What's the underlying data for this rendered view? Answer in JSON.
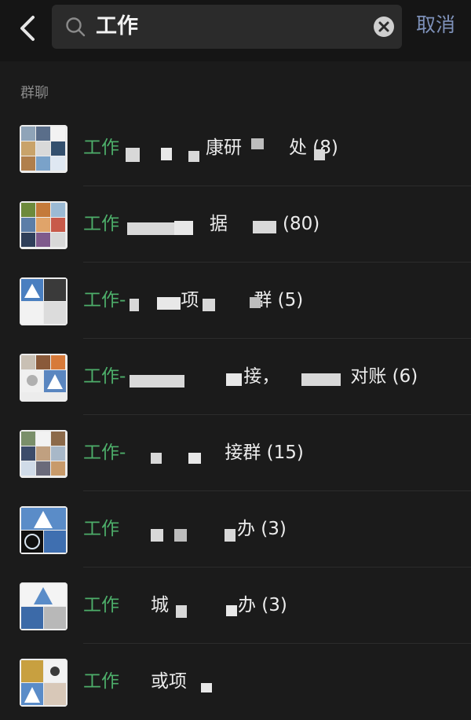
{
  "header": {
    "query": "工作",
    "cancel_label": "取消"
  },
  "section_label": "群聊",
  "results": [
    {
      "prefix": "工作",
      "middle": "康研",
      "end": "处 (8)"
    },
    {
      "prefix": "工作",
      "middle": "据",
      "end": "(80)"
    },
    {
      "prefix": "工作-",
      "middle": "项",
      "end": "群 (5)"
    },
    {
      "prefix": "工作-",
      "middle": "接，",
      "end": "对账 (6)"
    },
    {
      "prefix": "工作-",
      "middle": "",
      "end": "接群 (15)"
    },
    {
      "prefix": "工作",
      "middle": "",
      "end": "办 (3)"
    },
    {
      "prefix": "工作",
      "middle": "城",
      "end": "办 (3)"
    },
    {
      "prefix": "工作",
      "middle": "或项",
      "end": ""
    }
  ]
}
